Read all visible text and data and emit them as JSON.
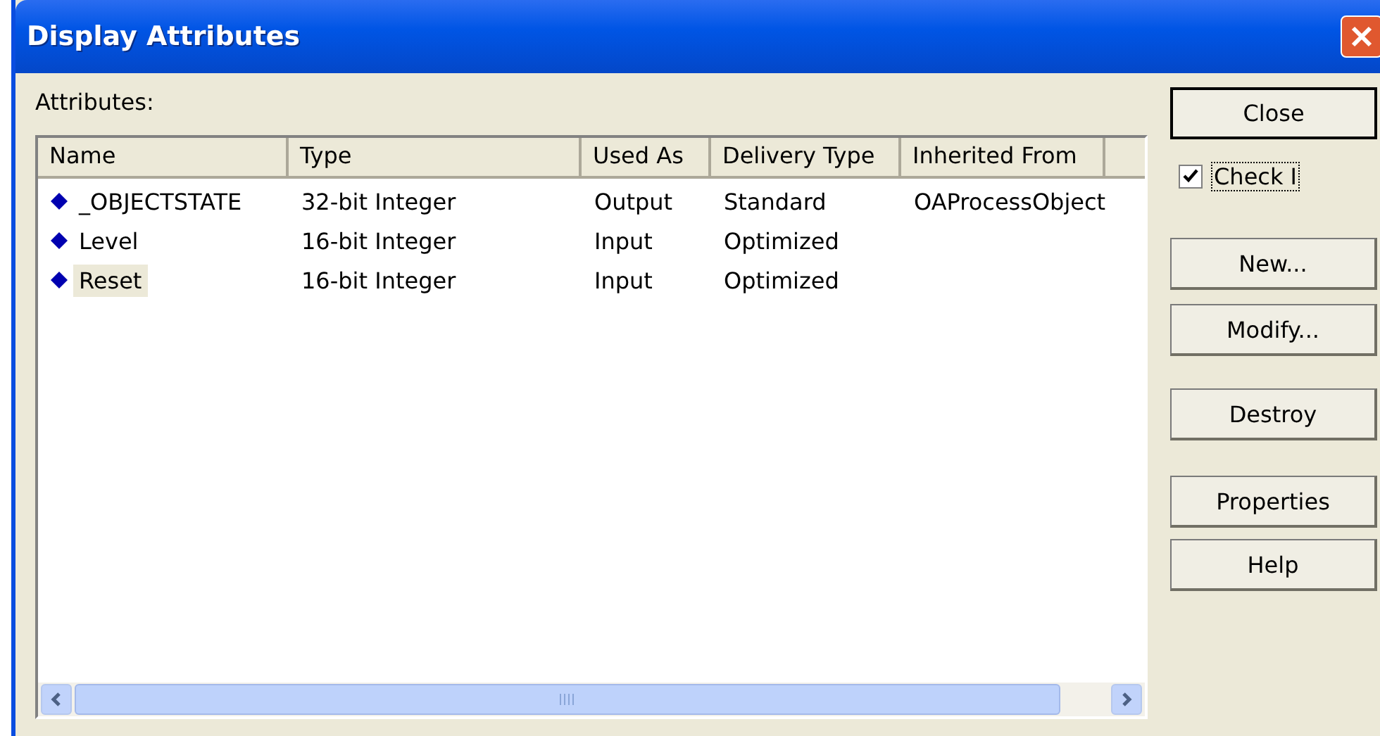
{
  "window": {
    "title": "Display Attributes"
  },
  "list_label": "Attributes:",
  "table": {
    "columns": [
      "Name",
      "Type",
      "Used As",
      "Delivery Type",
      "Inherited From"
    ],
    "rows": [
      {
        "cells": [
          "_OBJECTSTATE",
          "32-bit Integer",
          "Output",
          "Standard",
          "OAProcessObject"
        ],
        "selected": false
      },
      {
        "cells": [
          "Level",
          "16-bit Integer",
          "Input",
          "Optimized",
          ""
        ],
        "selected": false
      },
      {
        "cells": [
          "Reset",
          "16-bit Integer",
          "Input",
          "Optimized",
          ""
        ],
        "selected": true
      }
    ]
  },
  "buttons": [
    {
      "kind": "button",
      "label": "Close",
      "default": true
    },
    {
      "kind": "checkbox",
      "label": "Check I",
      "checked": true
    },
    {
      "kind": "button",
      "label": "New...",
      "default": false
    },
    {
      "kind": "button",
      "label": "Modify...",
      "default": false
    },
    {
      "kind": "button",
      "label": "Destroy",
      "default": false
    },
    {
      "kind": "button",
      "label": "Properties",
      "default": false
    },
    {
      "kind": "button",
      "label": "Help",
      "default": false
    }
  ]
}
